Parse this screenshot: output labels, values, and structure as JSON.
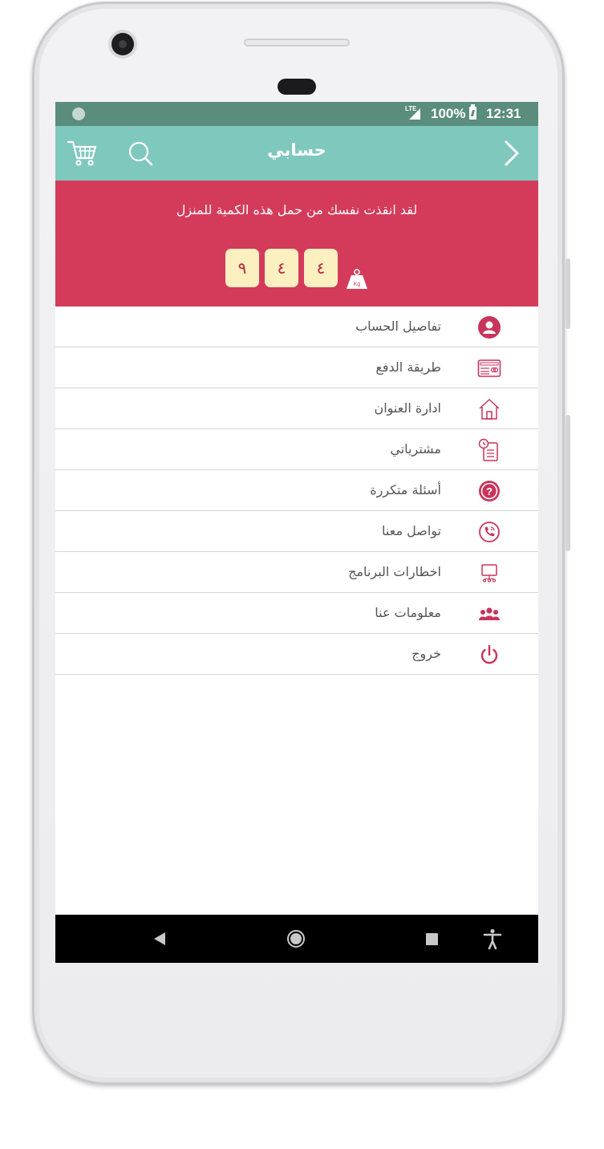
{
  "status_bar": {
    "network": "LTE",
    "battery": "100%",
    "time": "12:31"
  },
  "app_bar": {
    "title": "حسابي",
    "icons": [
      "chevron-right-icon",
      "search-icon",
      "cart-icon"
    ]
  },
  "banner": {
    "message": "لقد انقذت نفسك من حمل هذه الكمية للمنزل",
    "weight_digits": [
      "٩",
      "٤",
      "٤"
    ],
    "unit_label": "Kg"
  },
  "menu": {
    "items": [
      {
        "label": "تفاصيل الحساب",
        "icon": "user-icon"
      },
      {
        "label": "طريقة الدفع",
        "icon": "payment-card-icon"
      },
      {
        "label": "ادارة العنوان",
        "icon": "home-icon"
      },
      {
        "label": "مشترياتي",
        "icon": "purchases-icon"
      },
      {
        "label": "أسئلة متكررة",
        "icon": "question-icon"
      },
      {
        "label": "تواصل معنا",
        "icon": "phone-icon"
      },
      {
        "label": "اخطارات البرنامج",
        "icon": "notification-icon"
      },
      {
        "label": "معلومات عنا",
        "icon": "group-icon"
      },
      {
        "label": "خروج",
        "icon": "power-icon"
      }
    ]
  },
  "nav_bar": {
    "buttons": [
      "back-icon",
      "home-icon",
      "recents-icon",
      "accessibility-icon"
    ]
  },
  "colors": {
    "status_bar": "#5a8d7c",
    "app_bar": "#7fc8bd",
    "banner": "#d43b5b",
    "digit_box": "#fcefc0",
    "icon_accent": "#c8345a"
  }
}
